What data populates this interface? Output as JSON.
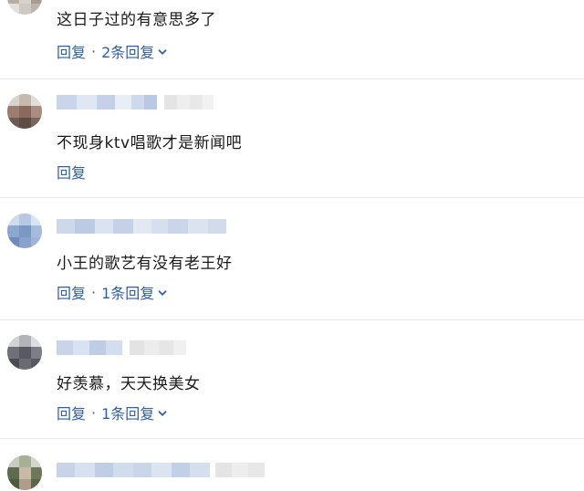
{
  "comments": [
    {
      "text": "这日子过的有意思多了",
      "reply_label": "回复",
      "replies_label": "2条回复"
    },
    {
      "text": "不现身ktv唱歌才是新闻吧",
      "reply_label": "回复"
    },
    {
      "text": "小王的歌艺有没有老王好",
      "reply_label": "回复",
      "replies_label": "1条回复"
    },
    {
      "text": "好羡慕，天天换美女",
      "reply_label": "回复",
      "replies_label": "1条回复"
    },
    {}
  ],
  "separator": "·",
  "colors": {
    "link": "#2f5fa7",
    "text": "#1a1a1a",
    "divider": "#e6e6e6"
  },
  "icons": {
    "expand": "chevron-down-icon"
  }
}
